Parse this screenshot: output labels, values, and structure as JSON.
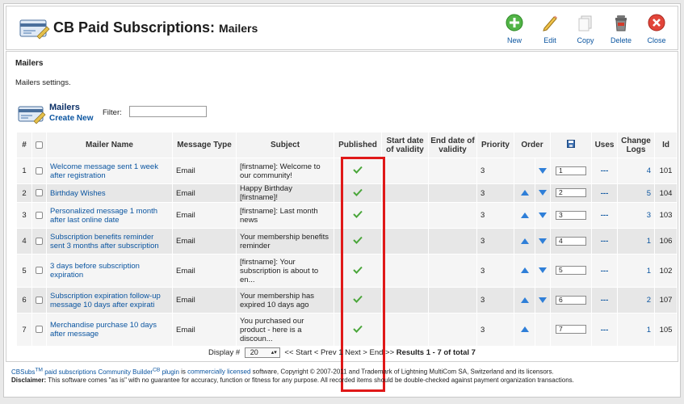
{
  "header": {
    "title": "CB Paid Subscriptions:",
    "subtitle": "Mailers",
    "toolbar": [
      {
        "name": "new-button",
        "label": "New",
        "icon": "plus-circle-icon"
      },
      {
        "name": "edit-button",
        "label": "Edit",
        "icon": "pencil-icon"
      },
      {
        "name": "copy-button",
        "label": "Copy",
        "icon": "copy-icon"
      },
      {
        "name": "delete-button",
        "label": "Delete",
        "icon": "trash-icon"
      },
      {
        "name": "close-button",
        "label": "Close",
        "icon": "close-circle-icon"
      }
    ]
  },
  "section": {
    "title": "Mailers",
    "description": "Mailers settings."
  },
  "mailers": {
    "title": "Mailers",
    "create_label": "Create New",
    "filter_label": "Filter:",
    "filter_value": ""
  },
  "table": {
    "columns": [
      "#",
      "",
      "Mailer Name",
      "Message Type",
      "Subject",
      "Published",
      "Start date of validity",
      "End date of validity",
      "Priority",
      "Order",
      "",
      "Uses",
      "Change Logs",
      "Id"
    ],
    "rows": [
      {
        "num": "1",
        "name": "Welcome message sent 1 week after registration",
        "type": "Email",
        "subject": "[firstname]: Welcome to our community!",
        "published": true,
        "start": "",
        "end": "",
        "priority": "3",
        "up": false,
        "down": true,
        "order": "1",
        "uses": "---",
        "logs": "4",
        "id": "101"
      },
      {
        "num": "2",
        "name": "Birthday Wishes",
        "type": "Email",
        "subject": "Happy Birthday [firstname]!",
        "published": true,
        "start": "",
        "end": "",
        "priority": "3",
        "up": true,
        "down": true,
        "order": "2",
        "uses": "---",
        "logs": "5",
        "id": "104"
      },
      {
        "num": "3",
        "name": "Personalized message 1 month after last online date",
        "type": "Email",
        "subject": "[firstname]: Last month news",
        "published": true,
        "start": "",
        "end": "",
        "priority": "3",
        "up": true,
        "down": true,
        "order": "3",
        "uses": "---",
        "logs": "3",
        "id": "103"
      },
      {
        "num": "4",
        "name": "Subscription benefits reminder sent 3 months after subscription",
        "type": "Email",
        "subject": "Your membership benefits reminder",
        "published": true,
        "start": "",
        "end": "",
        "priority": "3",
        "up": true,
        "down": true,
        "order": "4",
        "uses": "---",
        "logs": "1",
        "id": "106"
      },
      {
        "num": "5",
        "name": "3 days before subscription expiration",
        "type": "Email",
        "subject": "[firstname]: Your subscription is about to en...",
        "published": true,
        "start": "",
        "end": "",
        "priority": "3",
        "up": true,
        "down": true,
        "order": "5",
        "uses": "---",
        "logs": "1",
        "id": "102"
      },
      {
        "num": "6",
        "name": "Subscription expiration follow-up message 10 days after expirati",
        "type": "Email",
        "subject": "Your membership has expired 10 days ago",
        "published": true,
        "start": "",
        "end": "",
        "priority": "3",
        "up": true,
        "down": true,
        "order": "6",
        "uses": "---",
        "logs": "2",
        "id": "107"
      },
      {
        "num": "7",
        "name": "Merchandise purchase 10 days after message",
        "type": "Email",
        "subject": "You purchased our product - here is a discoun...",
        "published": true,
        "start": "",
        "end": "",
        "priority": "3",
        "up": true,
        "down": false,
        "order": "7",
        "uses": "---",
        "logs": "1",
        "id": "105"
      }
    ]
  },
  "pager": {
    "display_label": "Display #",
    "display_value": "20",
    "nav": "<< Start < Prev 1 Next > End >>",
    "results": "Results 1 - 7 of total 7"
  },
  "footer": {
    "brand": "CBSubs",
    "tm": "TM",
    "link1": "paid subscriptions",
    "link2": "Community Builder",
    "cb_sup": "CB",
    "link3": "plugin",
    "is": "is",
    "link4": "commercially licensed",
    "copy": "software, Copyright © 2007-2011 and Trademark of Lightning MultiCom SA, Switzerland and its licensors.",
    "disclaimer_label": "Disclaimer:",
    "disclaimer": "This software comes \"as is\" with no guarantee for accuracy, function or fitness for any purpose. All recorded items should be double-checked against payment organization transactions."
  },
  "colors": {
    "link": "#0b55a0",
    "highlight": "#e01818",
    "check": "#4aa63a",
    "arrow": "#2f7fd8"
  }
}
